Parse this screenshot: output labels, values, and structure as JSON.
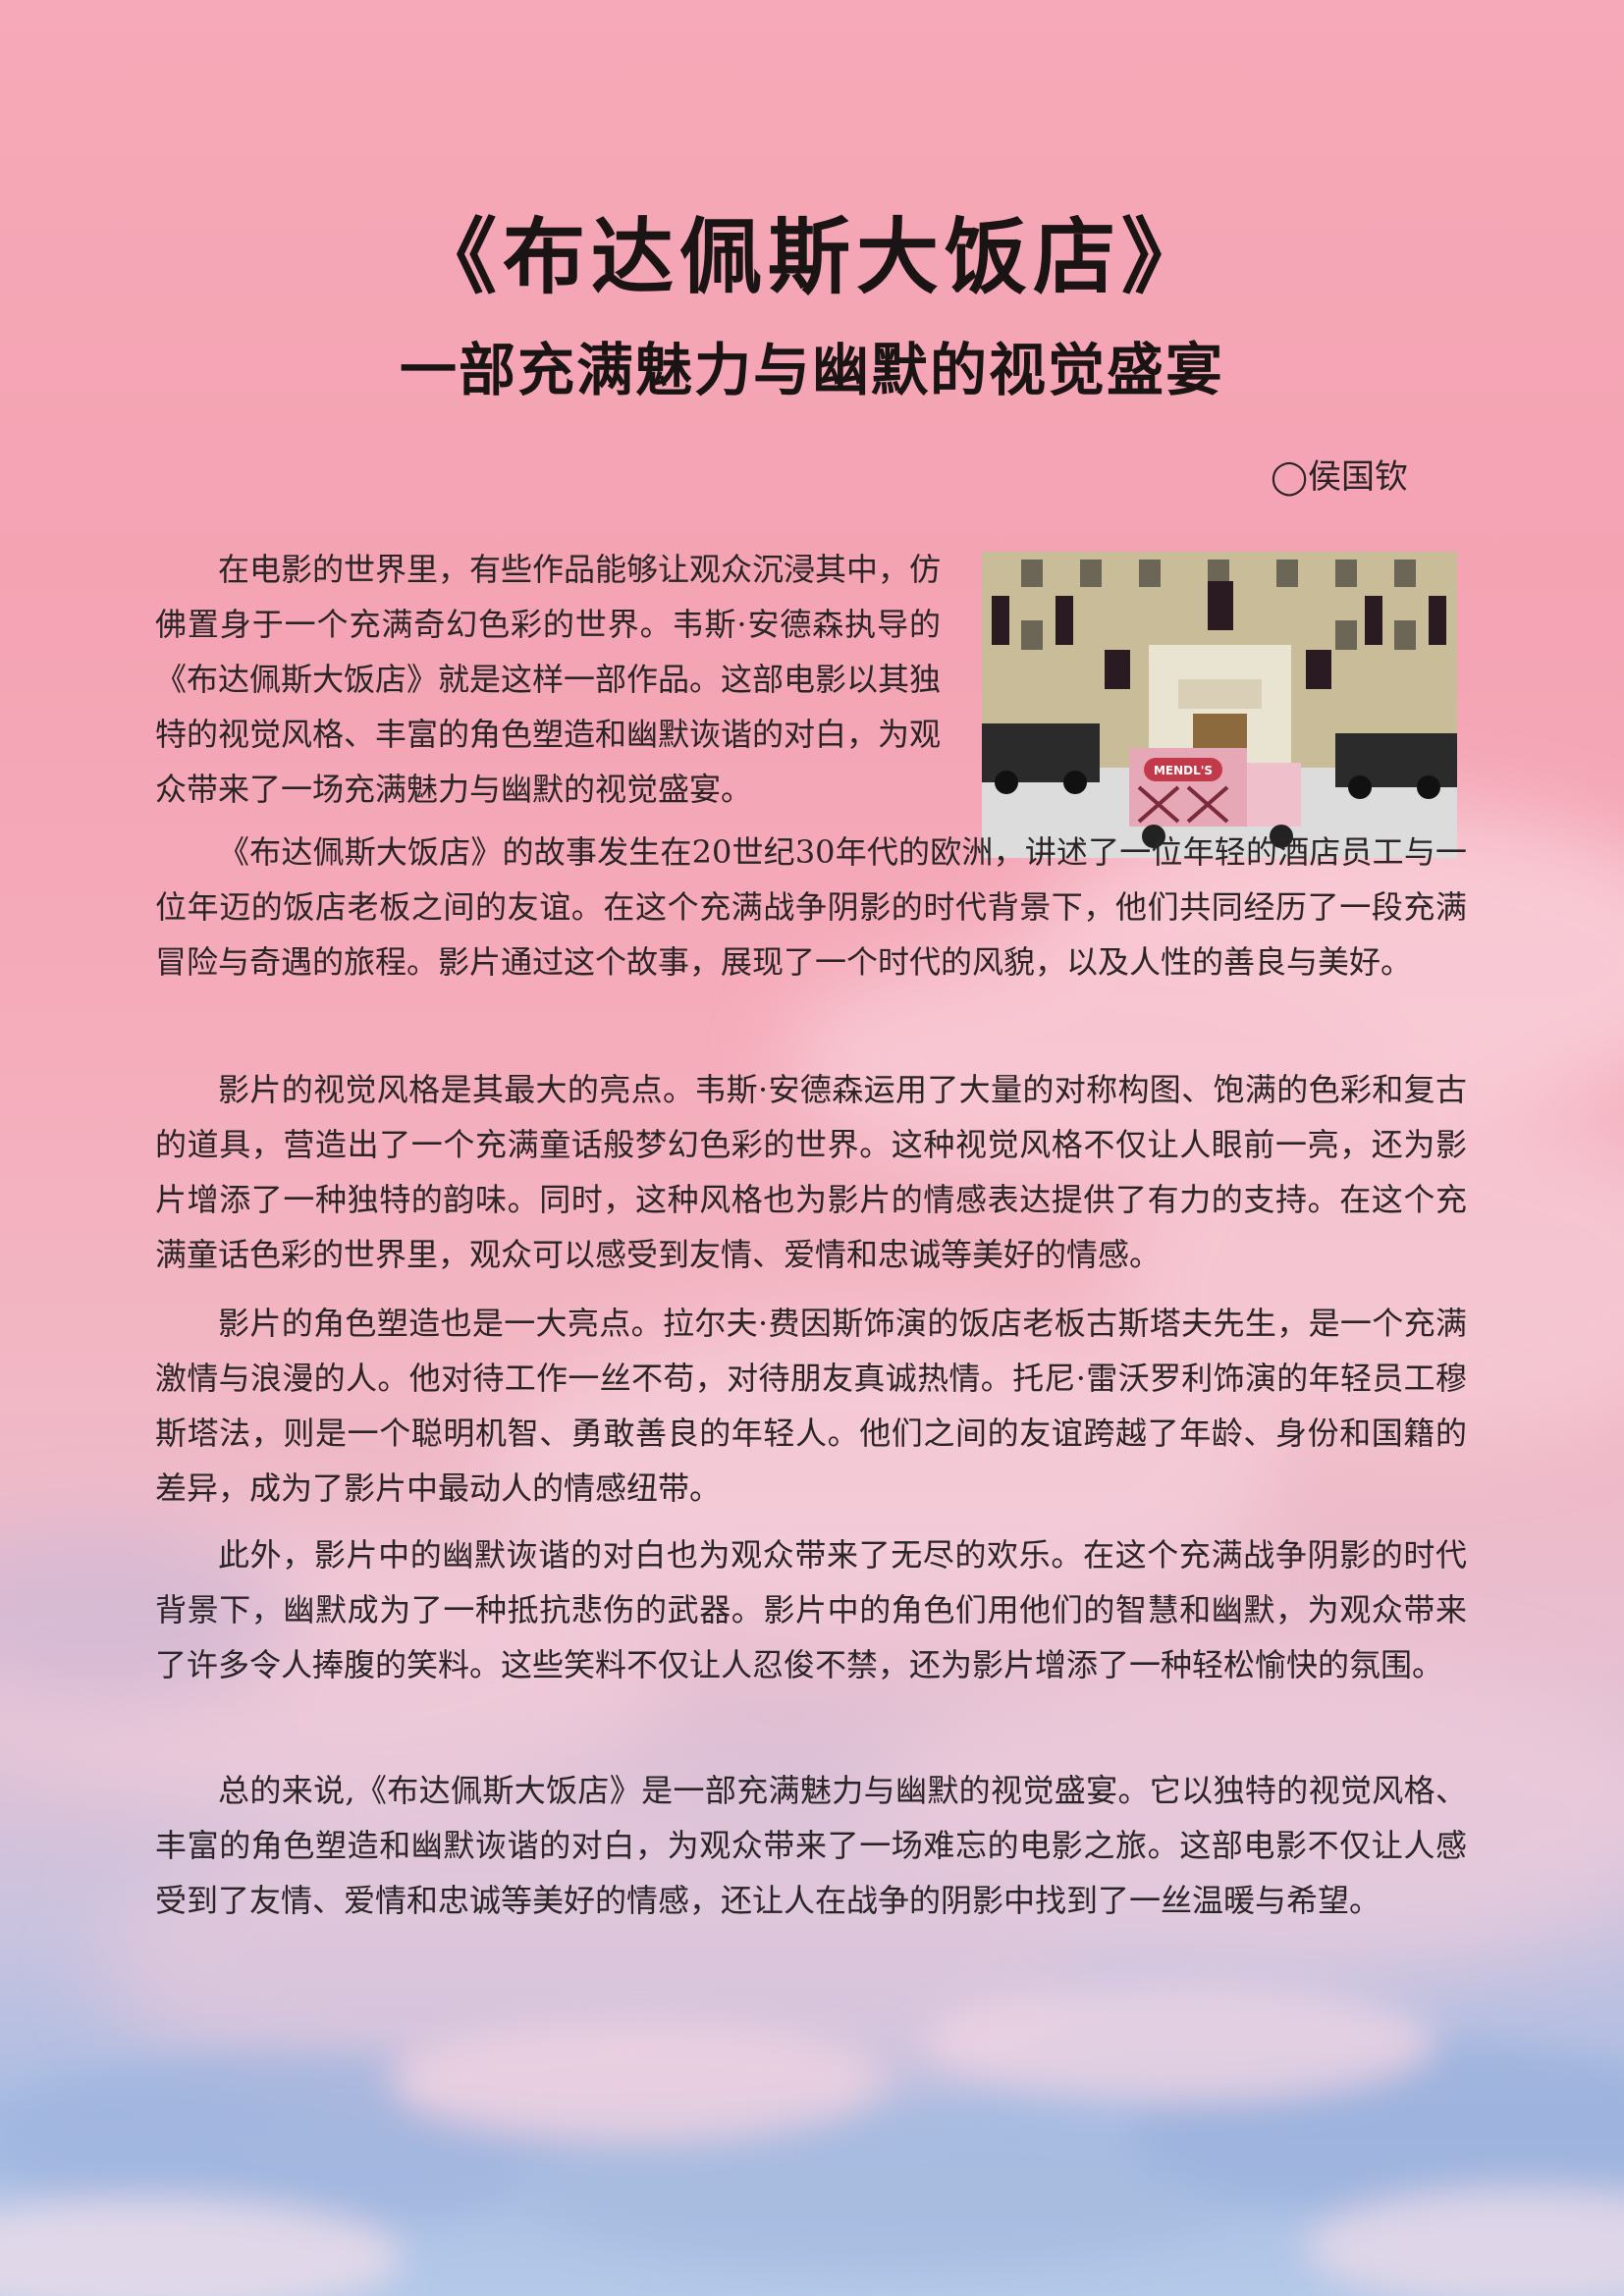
{
  "article": {
    "title": "《布达佩斯大饭店》",
    "subtitle": "一部充满魅力与幽默的视觉盛宴",
    "author": "◯侯国钦",
    "photo_sign": "MENDL'S",
    "paragraphs": [
      "在电影的世界里，有些作品能够让观众沉浸其中，仿佛置身于一个充满奇幻色彩的世界。韦斯·安德森执导的《布达佩斯大饭店》就是这样一部作品。这部电影以其独特的视觉风格、丰富的角色塑造和幽默诙谐的对白，为观众带来了一场充满魅力与幽默的视觉盛宴。",
      "《布达佩斯大饭店》的故事发生在20世纪30年代的欧洲，讲述了一位年轻的酒店员工与一位年迈的饭店老板之间的友谊。在这个充满战争阴影的时代背景下，他们共同经历了一段充满冒险与奇遇的旅程。影片通过这个故事，展现了一个时代的风貌，以及人性的善良与美好。",
      "影片的视觉风格是其最大的亮点。韦斯·安德森运用了大量的对称构图、饱满的色彩和复古的道具，营造出了一个充满童话般梦幻色彩的世界。这种视觉风格不仅让人眼前一亮，还为影片增添了一种独特的韵味。同时，这种风格也为影片的情感表达提供了有力的支持。在这个充满童话色彩的世界里，观众可以感受到友情、爱情和忠诚等美好的情感。",
      "影片的角色塑造也是一大亮点。拉尔夫·费因斯饰演的饭店老板古斯塔夫先生，是一个充满激情与浪漫的人。他对待工作一丝不苟，对待朋友真诚热情。托尼·雷沃罗利饰演的年轻员工穆斯塔法，则是一个聪明机智、勇敢善良的年轻人。他们之间的友谊跨越了年龄、身份和国籍的差异，成为了影片中最动人的情感纽带。",
      "此外，影片中的幽默诙谐的对白也为观众带来了无尽的欢乐。在这个充满战争阴影的时代背景下，幽默成为了一种抵抗悲伤的武器。影片中的角色们用他们的智慧和幽默，为观众带来了许多令人捧腹的笑料。这些笑料不仅让人忍俊不禁，还为影片增添了一种轻松愉快的氛围。",
      "总的来说,《布达佩斯大饭店》是一部充满魅力与幽默的视觉盛宴。它以独特的视觉风格、丰富的角色塑造和幽默诙谐的对白，为观众带来了一场难忘的电影之旅。这部电影不仅让人感受到了友情、爱情和忠诚等美好的情感，还让人在战争的阴影中找到了一丝温暖与希望。"
    ]
  }
}
